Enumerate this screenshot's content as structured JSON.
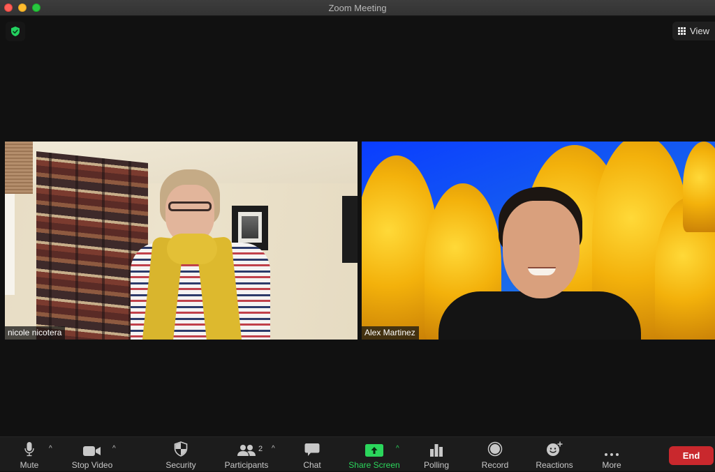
{
  "window": {
    "title": "Zoom Meeting"
  },
  "top_bar": {
    "security_badge_icon": "shield-check-icon",
    "view_button_label": "View",
    "view_button_icon": "grid-icon"
  },
  "participants": [
    {
      "name": "nicole nicotera",
      "background": "home-room"
    },
    {
      "name": "Alex Martinez",
      "background": "autumn-aspen-trees"
    }
  ],
  "toolbar": {
    "items": [
      {
        "id": "mute",
        "label": "Mute",
        "icon": "microphone-icon",
        "has_caret": true
      },
      {
        "id": "stop-video",
        "label": "Stop Video",
        "icon": "video-camera-icon",
        "has_caret": true
      },
      {
        "id": "security",
        "label": "Security",
        "icon": "shield-icon",
        "has_caret": false
      },
      {
        "id": "participants",
        "label": "Participants",
        "icon": "participants-icon",
        "has_caret": true,
        "count": "2"
      },
      {
        "id": "chat",
        "label": "Chat",
        "icon": "chat-bubble-icon",
        "has_caret": false
      },
      {
        "id": "share-screen",
        "label": "Share Screen",
        "icon": "share-screen-icon",
        "has_caret": true,
        "accent": "#2bd65c"
      },
      {
        "id": "polling",
        "label": "Polling",
        "icon": "bar-chart-icon",
        "has_caret": false
      },
      {
        "id": "record",
        "label": "Record",
        "icon": "record-icon",
        "has_caret": false
      },
      {
        "id": "reactions",
        "label": "Reactions",
        "icon": "smiley-plus-icon",
        "has_caret": false
      },
      {
        "id": "more",
        "label": "More",
        "icon": "ellipsis-icon",
        "has_caret": false
      }
    ],
    "end_label": "End",
    "end_color": "#c9282d"
  }
}
